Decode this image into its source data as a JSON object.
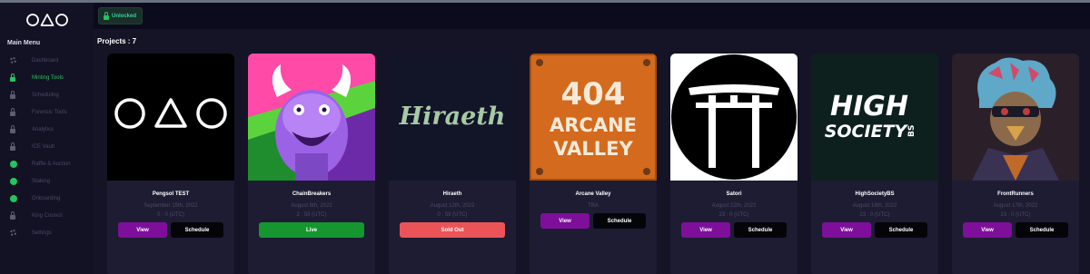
{
  "app": {
    "logo_name": "OΔO"
  },
  "sidebar": {
    "menu_title": "Main Menu",
    "items": [
      {
        "label": "Dashboard",
        "icon": "gear-icon",
        "active": false
      },
      {
        "label": "Minting Tools",
        "icon": "lock-icon",
        "active": true
      },
      {
        "label": "Scheduling",
        "icon": "lock-icon",
        "active": false
      },
      {
        "label": "Forensic Tools",
        "icon": "lock-icon",
        "active": false
      },
      {
        "label": "Analytics",
        "icon": "lock-icon",
        "active": false
      },
      {
        "label": "ICE Vault",
        "icon": "lock-icon",
        "active": false
      },
      {
        "label": "Raffle & Auction",
        "icon": "green-dot-icon",
        "active": false
      },
      {
        "label": "Staking",
        "icon": "green-dot-icon",
        "active": false
      },
      {
        "label": "Onboarding",
        "icon": "green-dot-icon",
        "active": false
      },
      {
        "label": "King Council",
        "icon": "lock-icon",
        "active": false
      },
      {
        "label": "Settings",
        "icon": "gear-icon",
        "active": false
      }
    ]
  },
  "header": {
    "badge_label": "Unlocked"
  },
  "main": {
    "projects_label": "Projects : 7"
  },
  "cards": [
    {
      "name": "Pengsol TEST",
      "line1": "September 15th, 2022",
      "line2": "0 : 0 (UTC)",
      "primary_button": "View",
      "secondary_button": "Schedule"
    },
    {
      "name": "ChainBreakers",
      "line1": "August 8th, 2022",
      "line2": "2 : 59 (UTC)",
      "status_button": "Live"
    },
    {
      "name": "Hiraeth",
      "line1": "August 12th, 2022",
      "line2": "0 : 59 (UTC)",
      "status_button": "Sold Out"
    },
    {
      "name": "Arcane Valley",
      "line1": "TBA",
      "primary_button": "View",
      "secondary_button": "Schedule"
    },
    {
      "name": "Satori",
      "line1": "August 22th, 2022",
      "line2": "23 : 0 (UTC)",
      "primary_button": "View",
      "secondary_button": "Schedule"
    },
    {
      "name": "HighSocietyBS",
      "line1": "August 18th, 2022",
      "line2": "23 : 0 (UTC)",
      "primary_button": "View",
      "secondary_button": "Schedule"
    },
    {
      "name": "FrontRunners",
      "line1": "August 17th, 2022",
      "line2": "23 : 0 (UTC)",
      "primary_button": "View",
      "secondary_button": "Schedule"
    }
  ],
  "images": {
    "hiraeth_text": "Hiraeth",
    "arcane_line1": "404",
    "arcane_line2": "ARCANE",
    "arcane_line3": "VALLEY",
    "hsbs_line1": "HIGH",
    "hsbs_line2": "SOCIETY",
    "hsbs_suffix": "BS"
  },
  "colors": {
    "accent_green": "#22c55e",
    "view_purple": "#7e0f9a",
    "live_green": "#15962f",
    "sold_out_red": "#ea5458"
  }
}
